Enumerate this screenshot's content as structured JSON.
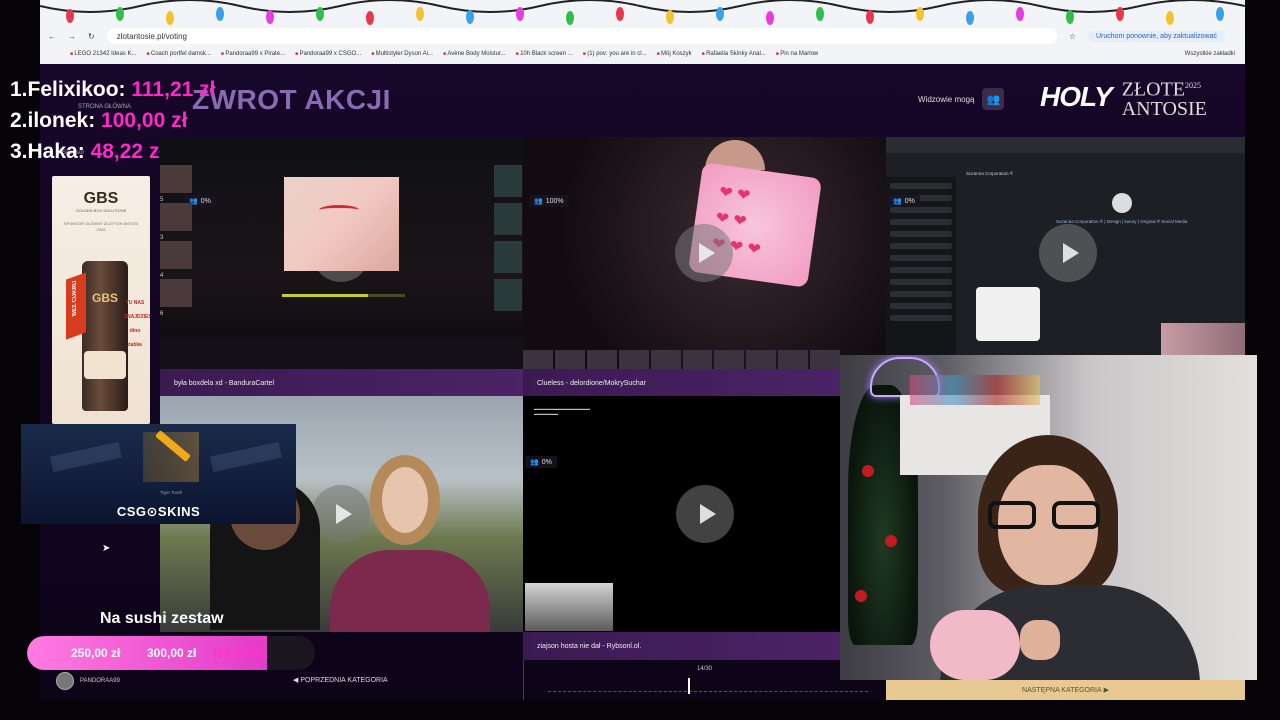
{
  "browser": {
    "url": "zlotantosie.pl/voting",
    "update_note": "Uruchom ponownie, aby zaktualizować",
    "bookmarks": [
      "LEGO 21342 Ideas K...",
      "Coach portfel damsk...",
      "Pandoraa99 x Pirate...",
      "Pandoraa99 x CSGO...",
      "Multistyler Dyson Ai...",
      "Avène Body Moistur...",
      "10h Black screen ...",
      "(1) pov: you are in cl...",
      "Mój Koszyk",
      "Rafaella Skinky Anal...",
      "Pin na Marlow"
    ],
    "all_bookmarks": "Wszystkie zakładki"
  },
  "leaderboard": [
    {
      "rank": "1.",
      "name": "Felixikoo:",
      "amount": "111,21 zł"
    },
    {
      "rank": "2.",
      "name": "ilonek:",
      "amount": "100,00 zł"
    },
    {
      "rank": "3.",
      "name": "Haka:",
      "amount": "48,22 zł"
    }
  ],
  "page": {
    "title": "ZWROT AKCJI",
    "start_link": "STRONA GŁÓWNA",
    "sponsor_label": "Sponsor",
    "viewers_label": "Widzowie mogą",
    "logo_holy": "HOLY",
    "logo_zlote": "ZŁOTE",
    "logo_antosie": "ANTOSIE",
    "logo_year": "2025"
  },
  "sponsor": {
    "brand": "GBS",
    "brand_sub": "GOLDEN BOX SOLUTIONS",
    "text": "SPONSOR GŁÓWNY ZŁOTYCH ANTOSI 2025",
    "can_brand": "GBS",
    "ribbon": "BEZ CUKRU",
    "side_text": "TU NAS ZNAJDZIESZ",
    "shops": [
      "dino",
      "żabka"
    ]
  },
  "videos": [
    {
      "badge": "0%",
      "caption": "była boxdela xd - BanduraCartel"
    },
    {
      "badge": "100%",
      "caption": "Clueless - delordione/MokrySuchar"
    },
    {
      "badge": "0%",
      "caption": ""
    },
    {
      "badge": "",
      "caption": ""
    },
    {
      "badge": "0%",
      "caption": "ziajson hosta nie dał - Rybsonl.ol."
    }
  ],
  "side_numbers": [
    "5",
    "3",
    "4",
    "6"
  ],
  "right_labels": [
    "PYK",
    "BAND",
    "TUSS"
  ],
  "stream_panel": {
    "handle": "Suzanna Corporation ® | Design | luxury | Original ® Social Media",
    "handle2": "Suzanna Corporation ®"
  },
  "csgo": {
    "logo": "CSG⊙SKINS",
    "knife_label": "Tiger Tooth"
  },
  "goal": {
    "title": "Na sushi zestaw",
    "current": "250,00 zł",
    "target": "300,00 zł",
    "percent": "(83.33%)",
    "progress": 0.8333
  },
  "user": {
    "name": "PANDORAA99"
  },
  "nav": {
    "prev": "POPRZEDNIA KATEGORIA",
    "next": "NASTĘPNA KATEGORIA",
    "counter": "14/30",
    "current_index": 14,
    "total": 30
  },
  "colors": {
    "accent": "#ff29c8",
    "title": "#8a6ab3",
    "next_bg": "#e7c991"
  }
}
